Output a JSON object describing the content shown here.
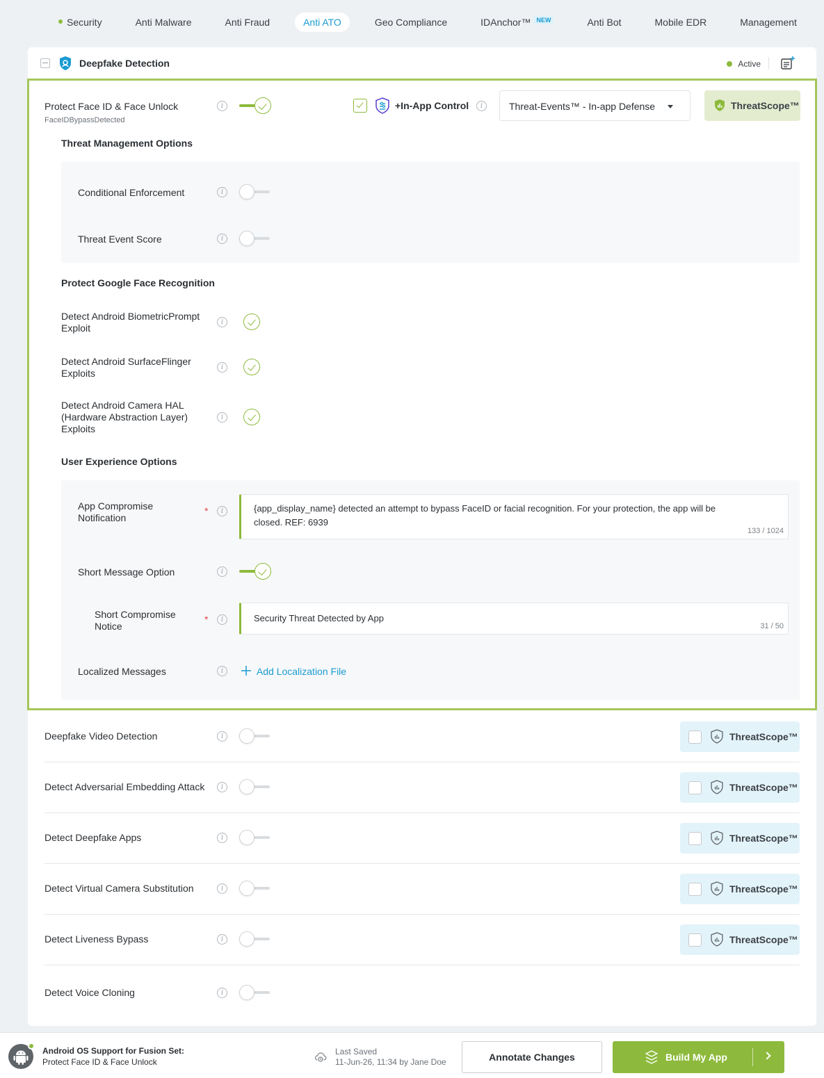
{
  "nav": {
    "items": [
      {
        "label": "Security",
        "dot": true
      },
      {
        "label": "Anti Malware"
      },
      {
        "label": "Anti Fraud"
      },
      {
        "label": "Anti ATO",
        "active": true
      },
      {
        "label": "Geo Compliance"
      },
      {
        "label": "IDAnchor™",
        "badge": "NEW"
      },
      {
        "label": "Anti Bot"
      },
      {
        "label": "Mobile EDR"
      },
      {
        "label": "Management"
      }
    ]
  },
  "card": {
    "title": "Deepfake Detection",
    "status": "Active",
    "status_color": "#8dba3c"
  },
  "faceid": {
    "label": "Protect Face ID & Face Unlock",
    "sublabel": "FaceIDBypassDetected",
    "enabled": true,
    "inapp_label": "+In-App Control",
    "inapp_checked": true,
    "dropdown_value": "Threat-Events™ - In-app Defense",
    "threatscope_label": "ThreatScope™"
  },
  "threat_mgmt": {
    "heading": "Threat Management Options",
    "conditional": {
      "label": "Conditional Enforcement",
      "enabled": false
    },
    "score": {
      "label": "Threat Event Score",
      "enabled": false
    }
  },
  "google": {
    "heading": "Protect Google Face Recognition",
    "items": [
      {
        "label_line1": "Detect Android BiometricPrompt",
        "label_line2": "Exploit",
        "checked": true
      },
      {
        "label_line1": "Detect Android SurfaceFlinger",
        "label_line2": "Exploits",
        "checked": true
      },
      {
        "label_line1": "Detect Android Camera HAL",
        "label_line2": "(Hardware Abstraction Layer)",
        "label_line3": "Exploits",
        "checked": true
      }
    ]
  },
  "ux": {
    "heading": "User Experience Options",
    "notification": {
      "label_line1": "App Compromise",
      "label_line2": "Notification",
      "required": "*",
      "value_line1": "{app_display_name} detected an attempt to bypass FaceID or facial recognition. For your protection, the app will be",
      "value_line2": "closed. REF: 6939",
      "counter": "133 / 1024"
    },
    "short_option": {
      "label": "Short Message Option",
      "enabled": true
    },
    "short_notice": {
      "label_line1": "Short Compromise",
      "label_line2": "Notice",
      "required": "*",
      "value": "Security Threat Detected by App",
      "counter": "31 / 50"
    },
    "localized": {
      "label": "Localized Messages",
      "link": "Add Localization File"
    }
  },
  "other_rows": [
    {
      "label": "Deepfake Video Detection",
      "threatscope": "ThreatScope™"
    },
    {
      "label": "Detect Adversarial Embedding Attack",
      "threatscope": "ThreatScope™"
    },
    {
      "label": "Detect Deepfake Apps",
      "threatscope": "ThreatScope™"
    },
    {
      "label": "Detect Virtual Camera Substitution",
      "threatscope": "ThreatScope™"
    },
    {
      "label": "Detect Liveness Bypass",
      "threatscope": "ThreatScope™"
    },
    {
      "label": "Detect Voice Cloning"
    }
  ],
  "footer": {
    "title": "Android OS Support for Fusion Set:",
    "subtitle": "Protect Face ID & Face Unlock",
    "saved_label": "Last Saved",
    "saved_value": "11-Jun-26, 11:34 by Jane Doe",
    "annotate_label": "Annotate Changes",
    "build_label": "Build My App"
  },
  "colors": {
    "accent_green": "#8dba3c",
    "accent_blue": "#1a9bd1",
    "selection_border": "#a5c65a"
  }
}
